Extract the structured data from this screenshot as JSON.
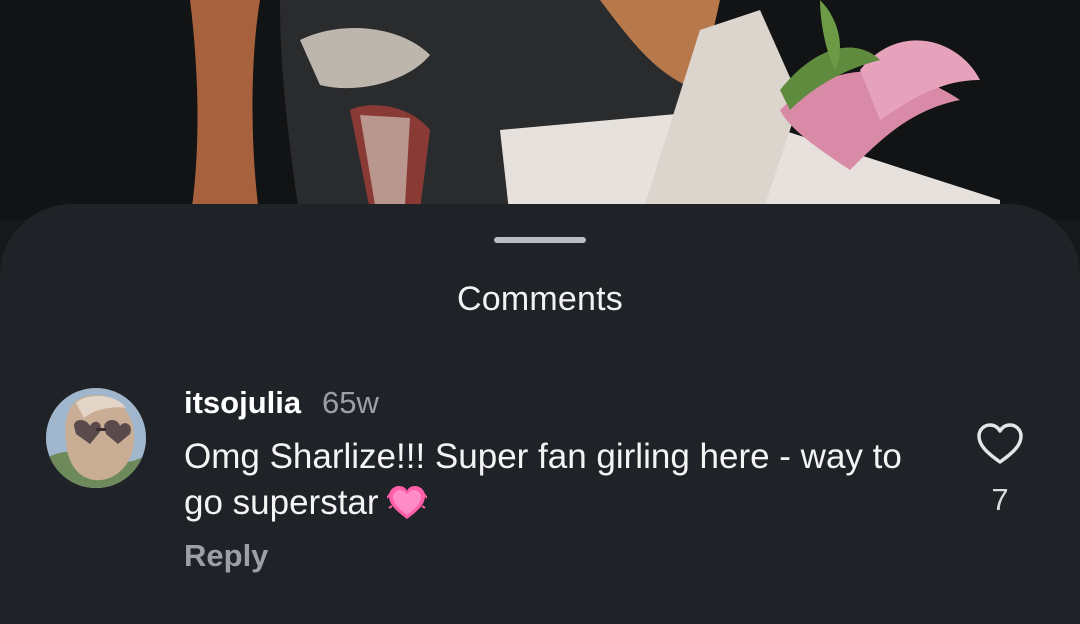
{
  "sheet": {
    "title": "Comments"
  },
  "comment": {
    "username": "itsojulia",
    "timestamp": "65w",
    "text": "Omg Sharlize!!! Super fan girling here - way to go superstar",
    "reply_label": "Reply",
    "like_count": "7"
  },
  "icons": {
    "like": "heart-outline-icon",
    "emoji": "growing-heart-emoji"
  },
  "colors": {
    "sheet_background": "#1f2226",
    "secondary_text": "#9aa0a6",
    "emoji_pink": "#ff5fa8"
  }
}
